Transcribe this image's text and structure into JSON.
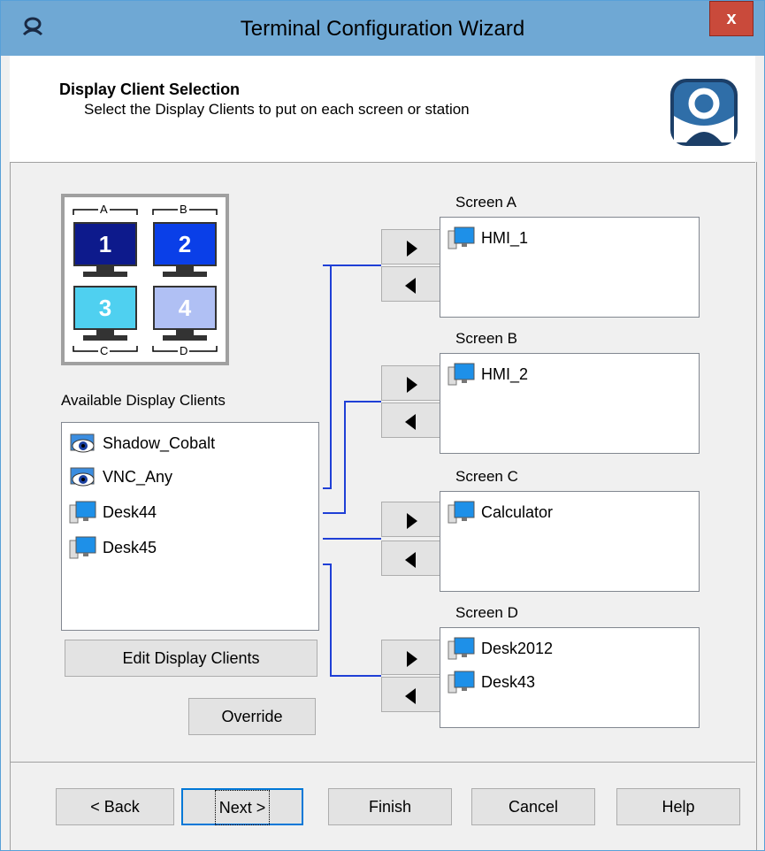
{
  "window": {
    "title": "Terminal Configuration Wizard",
    "close_label": "x"
  },
  "header": {
    "title": "Display Client Selection",
    "subtitle": "Select the Display Clients to put on each screen or station"
  },
  "monitors": {
    "labels": [
      "A",
      "B",
      "C",
      "D"
    ],
    "numbers": [
      "1",
      "2",
      "3",
      "4"
    ],
    "colors": [
      "#0d1a8c",
      "#0a3fe8",
      "#4fd0f0",
      "#b0c0f4"
    ]
  },
  "available": {
    "label": "Available Display Clients",
    "items": [
      {
        "name": "Shadow_Cobalt",
        "icon": "eye-icon"
      },
      {
        "name": "VNC_Any",
        "icon": "eye-icon"
      },
      {
        "name": "Desk44",
        "icon": "computer-icon"
      },
      {
        "name": "Desk45",
        "icon": "computer-icon"
      }
    ]
  },
  "buttons": {
    "edit": "Edit Display Clients",
    "override": "Override",
    "back": "< Back",
    "next": "Next >",
    "finish": "Finish",
    "cancel": "Cancel",
    "help": "Help"
  },
  "screens": [
    {
      "label": "Screen A",
      "items": [
        "HMI_1"
      ]
    },
    {
      "label": "Screen B",
      "items": [
        "HMI_2"
      ]
    },
    {
      "label": "Screen C",
      "items": [
        "Calculator"
      ]
    },
    {
      "label": "Screen D",
      "items": [
        "Desk2012",
        "Desk43"
      ]
    }
  ],
  "colors": {
    "title_bar": "#6fa8d4",
    "close_button": "#c94a3b",
    "connector_line": "#1f3fd6",
    "default_button_border": "#0078d7"
  }
}
